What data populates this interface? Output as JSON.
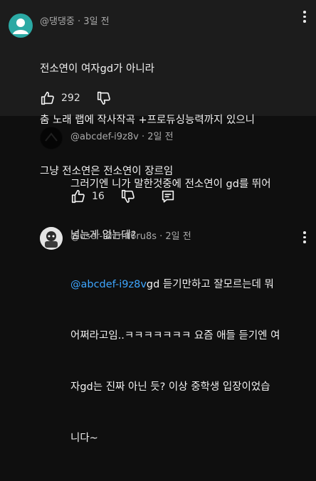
{
  "comments": [
    {
      "handle": "@댕댕중",
      "time": "3일 전",
      "lines": [
        "전소연이 여자gd가 아니라",
        "춤 노래 랩에 작사작곡 +프로듀싱능력까지 있으니",
        "그냥 전소연은 전소연이 장르임"
      ],
      "likes": "292",
      "avatar_color": "#2ba9a4"
    },
    {
      "handle": "@abcdef-i9z8v",
      "time": "2일 전",
      "lines": [
        "그러기엔 니가 말한것중에 전소연이 gd를 뛰어",
        "넘는게 없는데?"
      ],
      "likes": "16"
    },
    {
      "handle": "@user-rd1mf6ru8s",
      "time": "2일 전",
      "mention": "@abcdef-i9z8v",
      "first_line_rest": "gd 듣기만하고 잘모르는데 뭐",
      "lines": [
        "어쩌라고임..ㅋㅋㅋㅋㅋㅋㅋ 요즘 애들 듣기엔 여",
        "자gd는 진짜 아닌 듯? 이상 중학생 입장이었습",
        "니다~"
      ]
    }
  ],
  "icons": {
    "like": "thumbs-up-icon",
    "dislike": "thumbs-down-icon",
    "reply": "reply-comment-icon",
    "menu": "more-vert-icon"
  },
  "colors": {
    "background": "#0f0f0f",
    "highlight": "#1c1c1c",
    "mention": "#3ea6ff",
    "meta": "#aaaaaa"
  }
}
